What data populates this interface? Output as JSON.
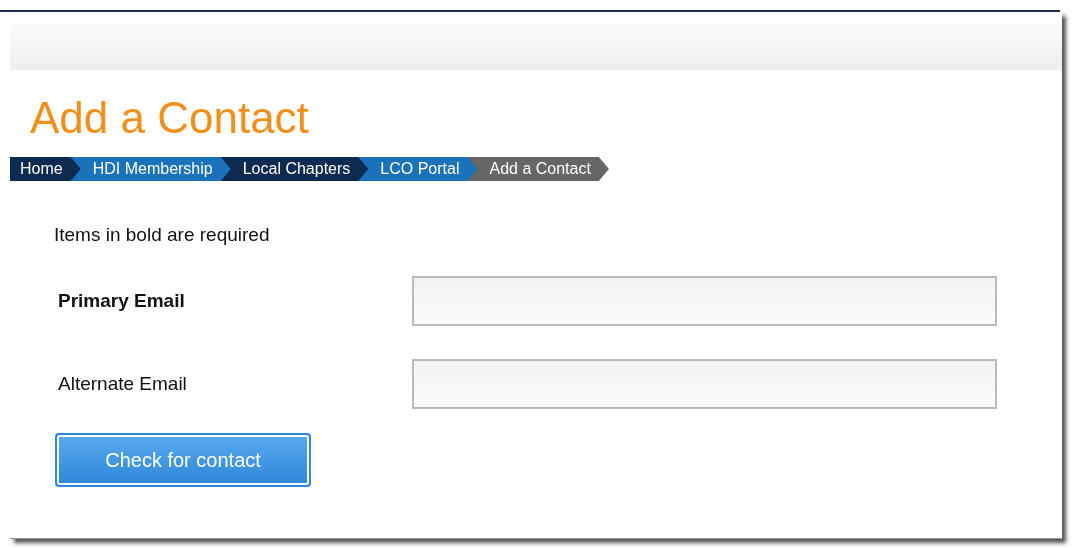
{
  "page_title": "Add a Contact",
  "breadcrumb": [
    {
      "label": "Home",
      "color": "#0d2b50"
    },
    {
      "label": "HDI Membership",
      "color": "#1a73ba"
    },
    {
      "label": "Local Chapters",
      "color": "#0d2b50"
    },
    {
      "label": "LCO Portal",
      "color": "#1a73ba"
    },
    {
      "label": "Add a Contact",
      "color": "#666666"
    }
  ],
  "note": "Items in bold are required",
  "fields": [
    {
      "label": "Primary Email",
      "required": true
    },
    {
      "label": "Alternate Email",
      "required": false
    }
  ],
  "button": "Check for contact"
}
